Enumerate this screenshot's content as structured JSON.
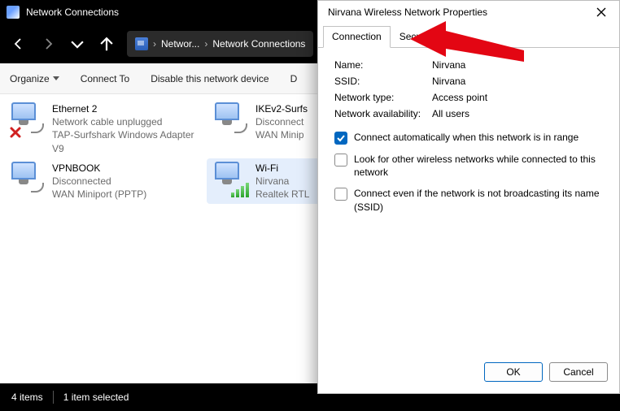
{
  "titlebar": {
    "title": "Network Connections"
  },
  "breadcrumb": {
    "seg1": "Networ...",
    "seg2": "Network Connections"
  },
  "toolbar": {
    "organize": "Organize",
    "connect": "Connect To",
    "disable": "Disable this network device",
    "diagnose": "D"
  },
  "adapters": [
    {
      "name": "Ethernet 2",
      "line2": "Network cable unplugged",
      "line3": "TAP-Surfshark Windows Adapter V9",
      "red_x": true,
      "wifi": false
    },
    {
      "name": "IKEv2-Surfs",
      "line2": "Disconnect",
      "line3": "WAN Minip",
      "red_x": false,
      "wifi": false
    },
    {
      "name": "VPNBOOK",
      "line2": "Disconnected",
      "line3": "WAN Miniport (PPTP)",
      "red_x": false,
      "wifi": false
    },
    {
      "name": "Wi-Fi",
      "line2": "Nirvana",
      "line3": "Realtek RTL",
      "red_x": false,
      "wifi": true
    }
  ],
  "status": {
    "count": "4 items",
    "selected": "1 item selected"
  },
  "dialog": {
    "title": "Nirvana Wireless Network Properties",
    "tabs": {
      "connection": "Connection",
      "security": "Security"
    },
    "props": {
      "name_label": "Name:",
      "name_value": "Nirvana",
      "ssid_label": "SSID:",
      "ssid_value": "Nirvana",
      "type_label": "Network type:",
      "type_value": "Access point",
      "avail_label": "Network availability:",
      "avail_value": "All users"
    },
    "checks": {
      "auto": "Connect automatically when this network is in range",
      "look": "Look for other wireless networks while connected to this network",
      "hidden": "Connect even if the network is not broadcasting its name (SSID)"
    },
    "buttons": {
      "ok": "OK",
      "cancel": "Cancel"
    }
  }
}
